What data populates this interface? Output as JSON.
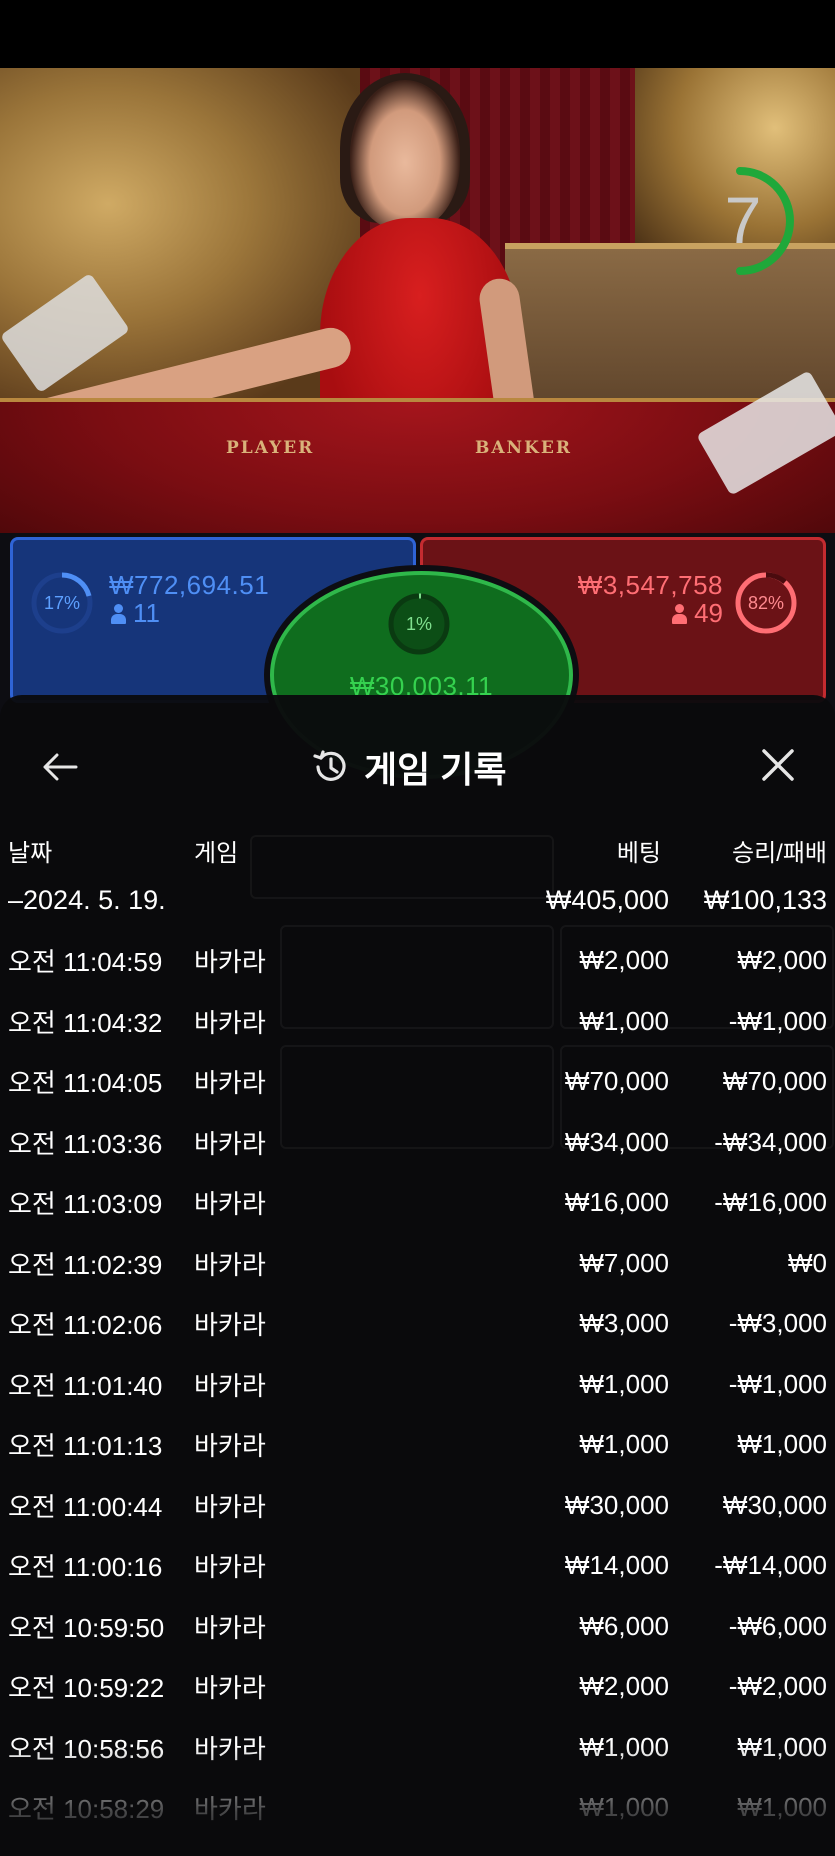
{
  "game": {
    "timer_value": "7",
    "felt_labels": [
      "PLAYER",
      "BANKER"
    ]
  },
  "bets": {
    "player": {
      "percent": "17%",
      "amount": "₩772,694.51",
      "players": "11",
      "color": "#2f64d6"
    },
    "tie": {
      "percent": "1%",
      "amount": "₩30,003.11",
      "color": "#2fb84a"
    },
    "banker": {
      "percent": "82%",
      "amount": "₩3,547,758",
      "players": "49",
      "color": "#c42b30"
    }
  },
  "history": {
    "title": "게임 기록",
    "icons": {
      "back": "arrow-left-icon",
      "title": "history-clock-icon",
      "close": "close-icon"
    },
    "columns": {
      "date": "날짜",
      "game": "게임",
      "bet": "베팅",
      "win_loss": "승리/패배"
    },
    "summary": {
      "date": "–2024. 5. 19.",
      "bet": "₩405,000",
      "win_loss": "₩100,133"
    },
    "rows": [
      {
        "time": "오전 11:04:59",
        "game": "바카라",
        "bet": "₩2,000",
        "win_loss": "₩2,000"
      },
      {
        "time": "오전 11:04:32",
        "game": "바카라",
        "bet": "₩1,000",
        "win_loss": "-₩1,000"
      },
      {
        "time": "오전 11:04:05",
        "game": "바카라",
        "bet": "₩70,000",
        "win_loss": "₩70,000"
      },
      {
        "time": "오전 11:03:36",
        "game": "바카라",
        "bet": "₩34,000",
        "win_loss": "-₩34,000"
      },
      {
        "time": "오전 11:03:09",
        "game": "바카라",
        "bet": "₩16,000",
        "win_loss": "-₩16,000"
      },
      {
        "time": "오전 11:02:39",
        "game": "바카라",
        "bet": "₩7,000",
        "win_loss": "₩0"
      },
      {
        "time": "오전 11:02:06",
        "game": "바카라",
        "bet": "₩3,000",
        "win_loss": "-₩3,000"
      },
      {
        "time": "오전 11:01:40",
        "game": "바카라",
        "bet": "₩1,000",
        "win_loss": "-₩1,000"
      },
      {
        "time": "오전 11:01:13",
        "game": "바카라",
        "bet": "₩1,000",
        "win_loss": "₩1,000"
      },
      {
        "time": "오전 11:00:44",
        "game": "바카라",
        "bet": "₩30,000",
        "win_loss": "₩30,000"
      },
      {
        "time": "오전 11:00:16",
        "game": "바카라",
        "bet": "₩14,000",
        "win_loss": "-₩14,000"
      },
      {
        "time": "오전 10:59:50",
        "game": "바카라",
        "bet": "₩6,000",
        "win_loss": "-₩6,000"
      },
      {
        "time": "오전 10:59:22",
        "game": "바카라",
        "bet": "₩2,000",
        "win_loss": "-₩2,000"
      },
      {
        "time": "오전 10:58:56",
        "game": "바카라",
        "bet": "₩1,000",
        "win_loss": "₩1,000"
      },
      {
        "time": "오전 10:58:29",
        "game": "바카라",
        "bet": "₩1,000",
        "win_loss": "₩1,000"
      }
    ]
  }
}
